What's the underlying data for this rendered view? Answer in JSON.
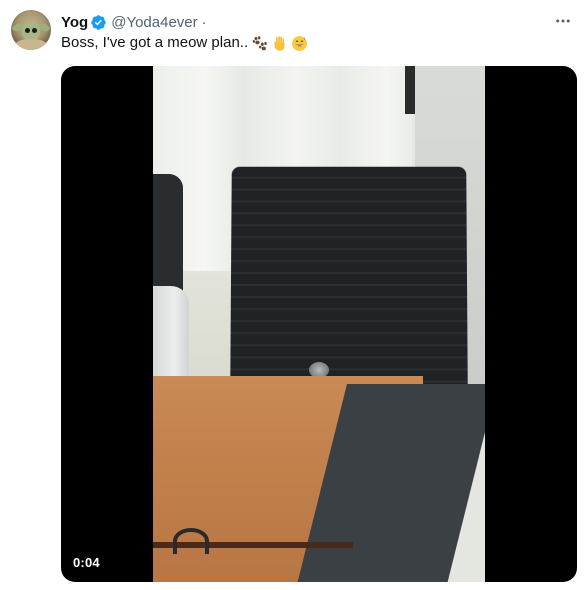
{
  "tweet": {
    "display_name": "Yog",
    "handle": "@Yoda4ever",
    "separator": "·",
    "text": "Boss, I've got a meow plan..",
    "emojis": [
      "paw-prints-emoji",
      "raised-hand-emoji",
      "grinning-sweat-emoji"
    ],
    "more_label": "···"
  },
  "media": {
    "type": "video",
    "duration": "0:04"
  },
  "colors": {
    "verified_blue": "#1d9bf0",
    "secondary_text": "#536471",
    "primary_text": "#0f1419"
  }
}
